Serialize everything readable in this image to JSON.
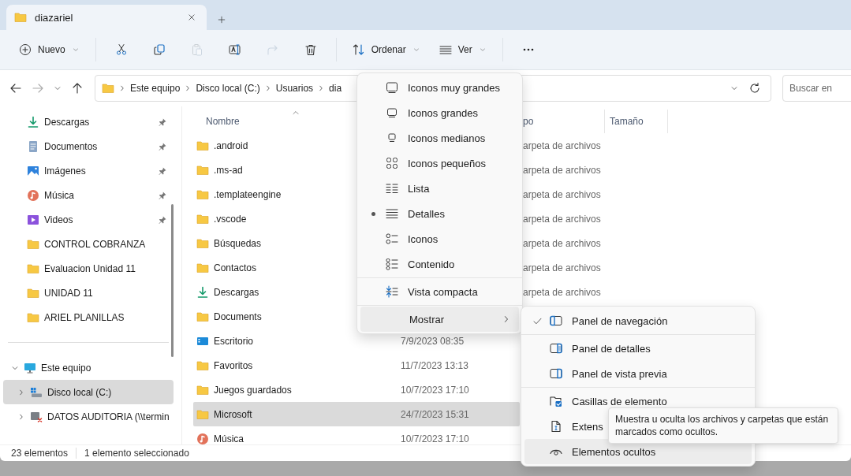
{
  "tab": {
    "title": "diazariel"
  },
  "toolbar": {
    "buttons": [
      {
        "label": "Nuevo",
        "disabled": false
      },
      {
        "disabled": false
      },
      {
        "disabled": false
      },
      {
        "disabled": true
      },
      {
        "disabled": false
      },
      {
        "disabled": true
      },
      {
        "disabled": false
      },
      {
        "label": "Ordenar",
        "disabled": false
      },
      {
        "label": "Ver",
        "disabled": false
      },
      {
        "disabled": false
      }
    ]
  },
  "address": {
    "crumbs": [
      "Este equipo",
      "Disco local (C:)",
      "Usuarios",
      "dia"
    ]
  },
  "search": {
    "placeholder": "Buscar en"
  },
  "sidebar": {
    "quick_access": [
      {
        "label": "Descargas",
        "kind": "downloads",
        "pinned": true,
        "selected": false
      },
      {
        "label": "Documentos",
        "kind": "documents",
        "pinned": true,
        "selected": false
      },
      {
        "label": "Imágenes",
        "kind": "pictures",
        "pinned": true,
        "selected": false
      },
      {
        "label": "Música",
        "kind": "music",
        "pinned": true,
        "selected": false
      },
      {
        "label": "Videos",
        "kind": "videos",
        "pinned": true,
        "selected": false
      },
      {
        "label": "CONTROL COBRANZA",
        "kind": "folder",
        "pinned": false,
        "selected": false
      },
      {
        "label": "Evaluacion Unidad 11",
        "kind": "folder",
        "pinned": false,
        "selected": false
      },
      {
        "label": "UNIDAD 11",
        "kind": "folder",
        "pinned": false,
        "selected": false
      },
      {
        "label": "ARIEL PLANILLAS",
        "kind": "folder",
        "pinned": false,
        "selected": false
      }
    ],
    "this_pc": {
      "label": "Este equipo",
      "expanded": true,
      "selected": false,
      "children": [
        {
          "label": "Disco local (C:)",
          "kind": "drive",
          "selected": true
        },
        {
          "label": "DATOS AUDITORIA (\\\\termin",
          "kind": "network",
          "selected": false
        }
      ]
    }
  },
  "files": {
    "columns": [
      {
        "label": "Nombre",
        "sorted": true
      },
      {
        "label": "po",
        "sorted": false
      },
      {
        "label": "Tamaño",
        "sorted": false
      }
    ],
    "rows": [
      {
        "name": ".android",
        "kind": "folder",
        "type": "arpeta de archivos",
        "selected": false
      },
      {
        "name": ".ms-ad",
        "kind": "folder",
        "type": "arpeta de archivos",
        "selected": false
      },
      {
        "name": ".templateengine",
        "kind": "folder",
        "type": "arpeta de archivos",
        "selected": false
      },
      {
        "name": ".vscode",
        "kind": "folder",
        "type": "arpeta de archivos",
        "selected": false
      },
      {
        "name": "Búsquedas",
        "kind": "folder",
        "type": "arpeta de archivos",
        "selected": false
      },
      {
        "name": "Contactos",
        "kind": "folder",
        "type": "arpeta de archivos",
        "selected": false
      },
      {
        "name": "Descargas",
        "kind": "downloads",
        "type": "arpeta de archivos",
        "selected": false
      },
      {
        "name": "Documents",
        "kind": "folder",
        "selected": false
      },
      {
        "name": "Escritorio",
        "kind": "desktop",
        "date": "7/9/2023 08:35",
        "selected": false
      },
      {
        "name": "Favoritos",
        "kind": "folder",
        "date": "11/7/2023 13:13",
        "selected": false
      },
      {
        "name": "Juegos guardados",
        "kind": "folder",
        "date": "10/7/2023 17:10",
        "selected": false
      },
      {
        "name": "Microsoft",
        "kind": "folder",
        "date": "24/7/2023 15:31",
        "selected": true
      },
      {
        "name": "Música",
        "kind": "music",
        "date": "10/7/2023 17:10",
        "selected": false
      }
    ]
  },
  "status_bar": {
    "count": "23 elementos",
    "selection": "1 elemento seleccionado"
  },
  "view_menu": {
    "groups": [
      [
        {
          "label": "Iconos muy grandes",
          "kind": "radio",
          "selected": false
        },
        {
          "label": "Iconos grandes",
          "kind": "radio",
          "selected": false
        },
        {
          "label": "Iconos medianos",
          "kind": "radio",
          "selected": false
        },
        {
          "label": "Iconos pequeños",
          "kind": "radio",
          "selected": false
        },
        {
          "label": "Lista",
          "kind": "radio",
          "selected": false
        },
        {
          "label": "Detalles",
          "kind": "radio",
          "selected": true
        },
        {
          "label": "Iconos",
          "kind": "radio",
          "selected": false
        },
        {
          "label": "Contenido",
          "kind": "radio",
          "selected": false
        }
      ],
      [
        {
          "label": "Vista compacta",
          "kind": "toggle",
          "checked": false
        }
      ],
      [
        {
          "label": "Mostrar",
          "kind": "submenu",
          "expanded": true
        }
      ]
    ]
  },
  "show_menu": {
    "groups": [
      [
        {
          "label": "Panel de navegación",
          "checked": true,
          "hovered": false
        }
      ],
      [
        {
          "label": "Panel de detalles",
          "checked": false,
          "hovered": false
        },
        {
          "label": "Panel de vista previa",
          "checked": false,
          "hovered": false
        }
      ],
      [
        {
          "label": "Casillas de elemento",
          "checked": false,
          "hovered": false
        },
        {
          "label": "Extens",
          "checked": false,
          "hovered": false
        },
        {
          "label": "Elementos ocultos",
          "checked": false,
          "hovered": true
        }
      ]
    ]
  },
  "tooltip": {
    "text": "Muestra u oculta los archivos y carpetas que están marcados como ocultos."
  }
}
